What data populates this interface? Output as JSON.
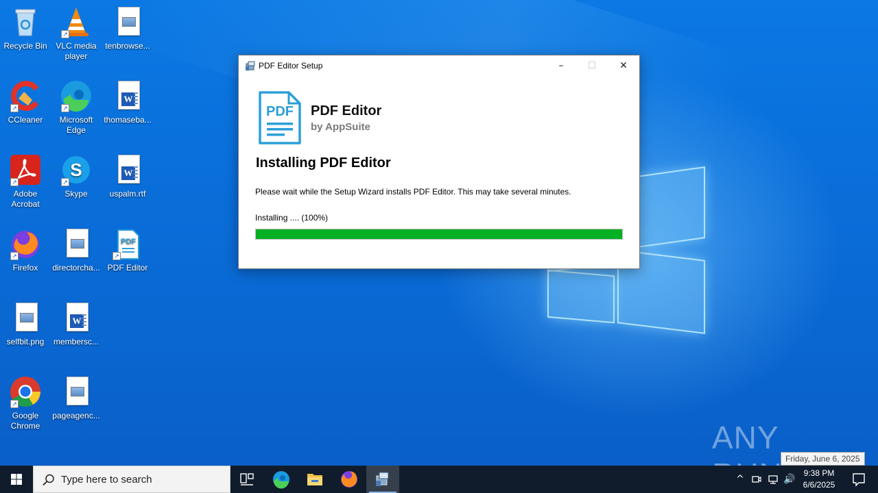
{
  "desktop": {
    "icons": [
      {
        "label": "Recycle Bin"
      },
      {
        "label": "VLC media player"
      },
      {
        "label": "tenbrowse..."
      },
      {
        "label": "CCleaner"
      },
      {
        "label": "Microsoft Edge"
      },
      {
        "label": "thomaseba..."
      },
      {
        "label": "Adobe Acrobat"
      },
      {
        "label": "Skype"
      },
      {
        "label": "uspalm.rtf"
      },
      {
        "label": "Firefox"
      },
      {
        "label": "directorcha..."
      },
      {
        "label": "PDF Editor"
      },
      {
        "label": "selfbit.png"
      },
      {
        "label": "membersc..."
      },
      {
        "label": "Google Chrome"
      },
      {
        "label": "pageagenc..."
      }
    ]
  },
  "installer": {
    "title": "PDF Editor Setup",
    "logo_text": "PDF",
    "app_name": "PDF Editor",
    "vendor": "by AppSuite",
    "heading": "Installing PDF Editor",
    "description": "Please wait while the Setup Wizard installs PDF Editor. This may take several minutes.",
    "status": "Installing .... (100%)",
    "progress": 1.0,
    "progress_color": "#06b025",
    "buttons": {
      "minimize": "–",
      "maximize": "☐",
      "close": "✕"
    }
  },
  "watermark": {
    "text": "ANY RUN"
  },
  "tooltip": {
    "text": "Friday, June 6, 2025"
  },
  "taskbar": {
    "search_placeholder": "Type here to search",
    "apps": [
      "task-view-icon",
      "edge-icon",
      "file-explorer-icon",
      "firefox-icon",
      "installer-icon"
    ],
    "clock": {
      "time": "9:38 PM",
      "date": "6/6/2025"
    },
    "tray_glyphs": {
      "chevron": "^",
      "volume": "🔊"
    }
  },
  "colors": {
    "accent": "#0078d7",
    "taskbar": "#101c2c",
    "pdf_blue": "#2b9fd9"
  }
}
